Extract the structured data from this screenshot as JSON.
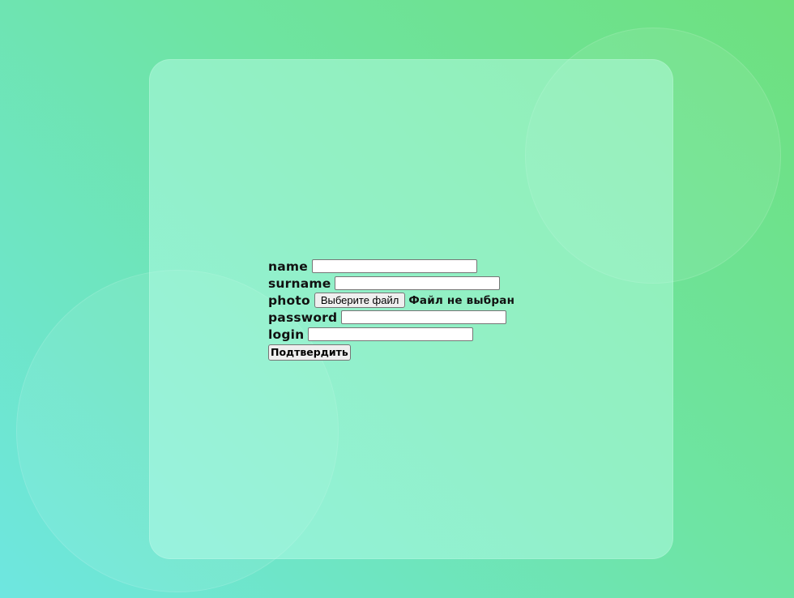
{
  "form": {
    "fields": [
      {
        "key": "name",
        "label": "name",
        "value": ""
      },
      {
        "key": "surname",
        "label": "surname",
        "value": ""
      },
      {
        "key": "password",
        "label": "password",
        "value": ""
      },
      {
        "key": "login",
        "label": "login",
        "value": ""
      }
    ],
    "photo": {
      "label": "photo",
      "button_label": "Выберите файл",
      "status": "Файл не выбран"
    },
    "submit_label": "Подтвердить"
  },
  "colors": {
    "background_top_right": "#6ee07e",
    "background_bottom_left": "#6ee6e0",
    "card": "#a0f2d8"
  }
}
